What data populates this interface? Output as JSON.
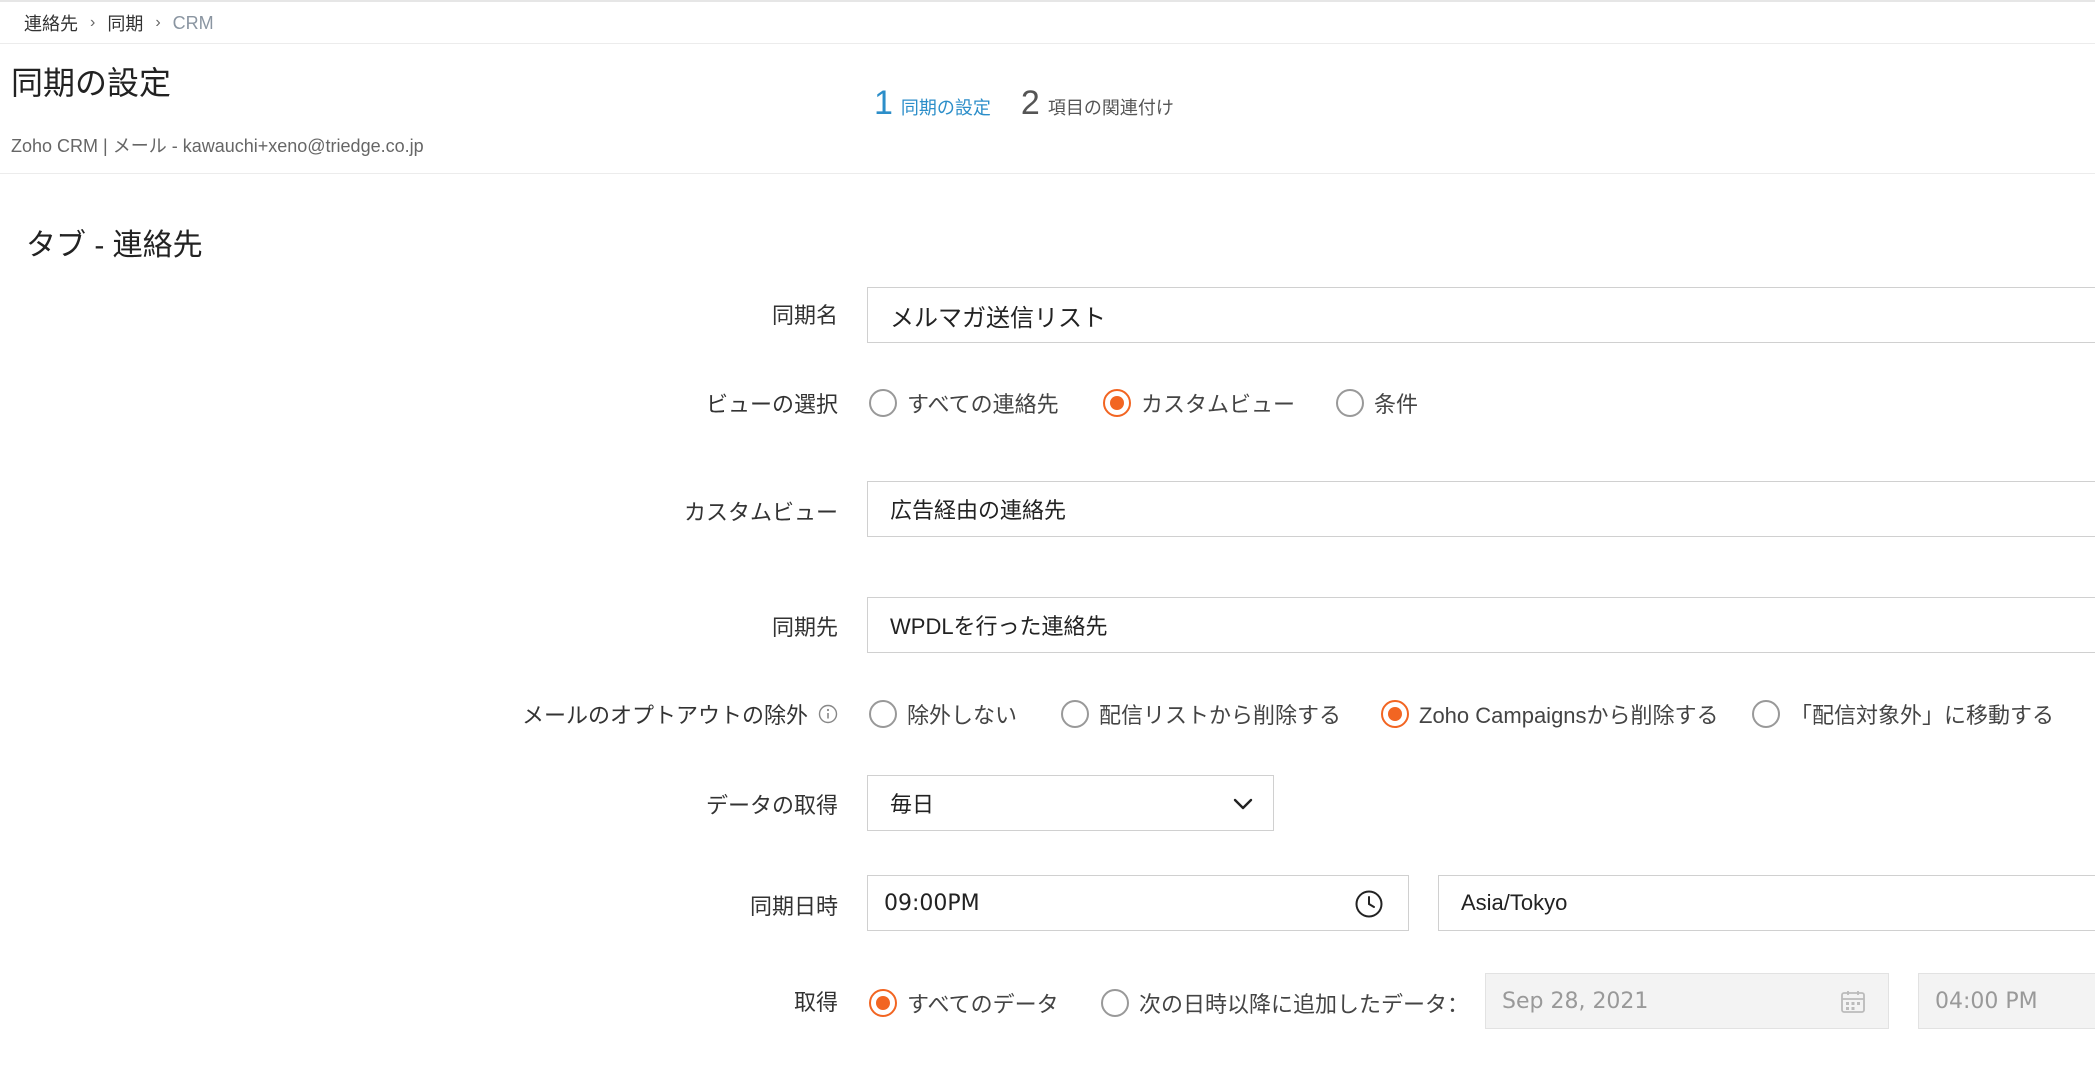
{
  "breadcrumb": {
    "items": [
      "連絡先",
      "同期",
      "CRM"
    ],
    "separator": "›"
  },
  "header": {
    "title": "同期の設定",
    "subtitle": "Zoho CRM | メール - kawauchi+xeno@triedge.co.jp",
    "steps": [
      {
        "num": "1",
        "label": "同期の設定",
        "state": "active"
      },
      {
        "num": "2",
        "label": "項目の関連付け",
        "state": "inactive"
      }
    ]
  },
  "section": {
    "title": "タブ - 連絡先"
  },
  "form": {
    "sync_name": {
      "label": "同期名",
      "value": "メルマガ送信リスト"
    },
    "view_select": {
      "label": "ビューの選択",
      "options": [
        "すべての連絡先",
        "カスタムビュー",
        "条件"
      ],
      "selected": "カスタムビュー"
    },
    "custom_view": {
      "label": "カスタムビュー",
      "value": "広告経由の連絡先"
    },
    "sync_target": {
      "label": "同期先",
      "value": "WPDLを行った連絡先"
    },
    "optout": {
      "label": "メールのオプトアウトの除外",
      "icon": "info-icon",
      "options": [
        "除外しない",
        "配信リストから削除する",
        "Zoho Campaignsから削除する",
        "「配信対象外」に移動する"
      ],
      "selected": "Zoho Campaignsから削除する"
    },
    "data_fetch": {
      "label": "データの取得",
      "value": "毎日",
      "icon": "chevron-down-icon"
    },
    "sync_time": {
      "label": "同期日時",
      "time": "09:00PM",
      "time_icon": "clock-icon",
      "timezone": "Asia/Tokyo"
    },
    "fetch": {
      "label": "取得",
      "options": [
        "すべてのデータ",
        "次の日時以降に追加したデータ："
      ],
      "selected": "すべてのデータ",
      "date": "Sep 28, 2021",
      "date_icon": "calendar-icon",
      "time": "04:00 PM"
    }
  },
  "colors": {
    "accent": "#f26522",
    "step_active": "#2c8ec9",
    "border": "#d0d0d0"
  }
}
